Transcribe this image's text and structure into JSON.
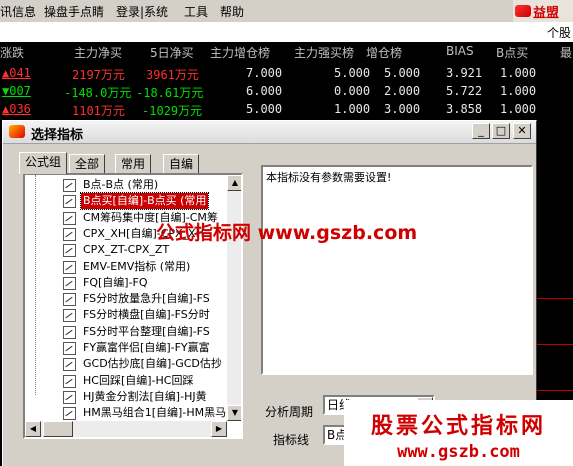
{
  "menu": {
    "items": [
      "讯信息",
      "操盘手点睛",
      "登录|系统",
      "工具",
      "帮助"
    ],
    "brand": "益盟"
  },
  "subbar": {
    "text": "个股"
  },
  "table": {
    "headers": [
      "涨跌",
      "主力净买",
      "5日净买",
      "主力增仓榜",
      "主力强买榜",
      "增仓榜",
      "BIAS",
      "B点买",
      "最"
    ],
    "rows": [
      {
        "chg": "▲041",
        "main_net": "2197万元",
        "net5": "3961万元",
        "inc": "7.000",
        "strong": "5.000",
        "add": "5.000",
        "bias": "3.921",
        "b": "1.000"
      },
      {
        "chg": "▼007",
        "main_net": "-148.0万元",
        "net5": "-18.61万元",
        "inc": "6.000",
        "strong": "0.000",
        "add": "2.000",
        "bias": "5.722",
        "b": "1.000"
      },
      {
        "chg": "▲036",
        "main_net": "1101万元",
        "net5": "-1029万元",
        "inc": "5.000",
        "strong": "1.000",
        "add": "3.000",
        "bias": "3.858",
        "b": "1.000"
      }
    ]
  },
  "dialog": {
    "title": "选择指标",
    "tabs": [
      "公式组",
      "全部",
      "常用",
      "自编"
    ],
    "indicators": [
      "B点-B点 (常用)",
      "B点买[自编]-B点买 (常用",
      "CM筹码集中度[自编]-CM筹",
      "CPX_XH[自编]-CPX_XH",
      "CPX_ZT-CPX_ZT",
      "EMV-EMV指标 (常用)",
      "FQ[自编]-FQ",
      "FS分时放量急升[自编]-FS",
      "FS分时横盘[自编]-FS分时",
      "FS分时平台整理[自编]-FS",
      "FY赢富伴侣[自编]-FY赢富",
      "GCD估抄底[自编]-GCD估抄",
      "HC回踩[自编]-HC回踩",
      "HJ黄金分割法[自编]-HJ黄",
      "HM黑马组合1[自编]-HM黑马"
    ],
    "selected_index": 1,
    "description": "本指标没有参数需要设置!",
    "period_label": "分析周期",
    "period_value": "日线",
    "line_label": "指标线",
    "line_value": "B点"
  },
  "watermarks": {
    "center": "公式指标网  www.gszb.com",
    "corner_title": "股票公式指标网",
    "corner_url": "www.gszb.com"
  },
  "colors": {
    "up": "#ff3030",
    "down": "#00e000",
    "selected": "#c80000"
  }
}
